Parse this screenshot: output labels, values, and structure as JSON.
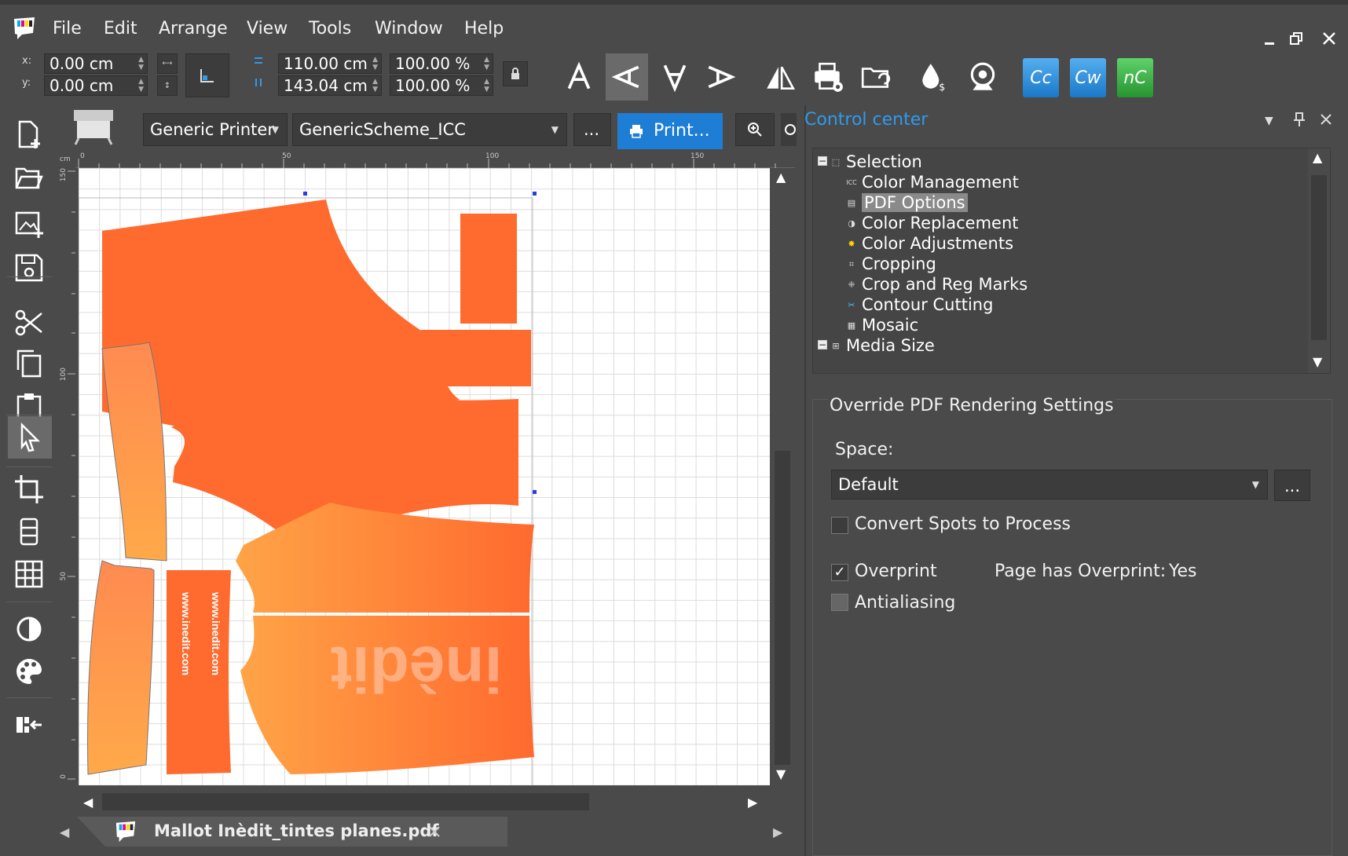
{
  "app": {
    "title": ""
  },
  "menu": [
    "File",
    "Edit",
    "Arrange",
    "View",
    "Tools",
    "Window",
    "Help"
  ],
  "toolbar": {
    "x_label": "x:",
    "y_label": "y:",
    "x_value": "0.00 cm",
    "y_value": "0.00 cm",
    "width_value": "110.00 cm",
    "height_value": "143.04 cm",
    "scale_x": "100.00 %",
    "scale_y": "100.00 %",
    "integrations": [
      "Cc",
      "Cw",
      "nC"
    ],
    "integration_colors": [
      "#2a8ee0",
      "#2a8ee0",
      "#3bb24a"
    ]
  },
  "docbar": {
    "printer": "Generic Printer",
    "scheme": "GenericScheme_ICC",
    "more_label": "...",
    "print_label": "Print..."
  },
  "ruler": {
    "unit": "cm",
    "h_ticks": [
      "0",
      "50",
      "100",
      "150"
    ],
    "v_ticks": [
      "150",
      "100",
      "50",
      "0"
    ]
  },
  "canvas": {
    "text_url_1": "www.inedit.com",
    "text_url_2": "www.inedit.com",
    "watermark": "inèdit",
    "piece_color": "#ff6a2e",
    "gradient_color": "#ffa04a"
  },
  "document_tab": {
    "name": "Mallot Inèdit_tintes planes.pdf"
  },
  "control_center": {
    "title": "Control center",
    "tree": [
      {
        "label": "Selection",
        "icon": "selection-icon",
        "level": 0,
        "expanded": true
      },
      {
        "label": "Color Management",
        "icon": "icc-icon",
        "level": 1
      },
      {
        "label": "PDF Options",
        "icon": "pdf-icon",
        "level": 1,
        "selected": true
      },
      {
        "label": "Color Replacement",
        "icon": "color-replace-icon",
        "level": 1
      },
      {
        "label": "Color Adjustments",
        "icon": "color-adjust-icon",
        "level": 1
      },
      {
        "label": "Cropping",
        "icon": "crop-icon",
        "level": 1
      },
      {
        "label": "Crop and Reg Marks",
        "icon": "reg-marks-icon",
        "level": 1
      },
      {
        "label": "Contour Cutting",
        "icon": "contour-icon",
        "level": 1
      },
      {
        "label": "Mosaic",
        "icon": "mosaic-icon",
        "level": 1
      },
      {
        "label": "Media Size",
        "icon": "media-size-icon",
        "level": 0,
        "expanded": true
      }
    ],
    "section_title": "Override PDF Rendering Settings",
    "space_label": "Space:",
    "space_value": "Default",
    "space_more": "...",
    "convert_spots_label": "Convert Spots to Process",
    "convert_spots_checked": false,
    "overprint_label": "Overprint",
    "overprint_checked": true,
    "page_overprint_label": "Page has Overprint:",
    "page_overprint_value": "Yes",
    "antialiasing_label": "Antialiasing",
    "antialiasing_checked": false
  }
}
